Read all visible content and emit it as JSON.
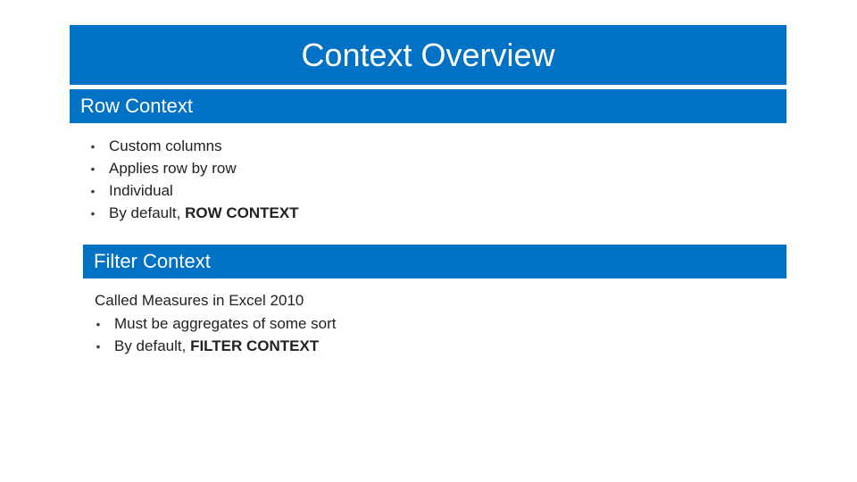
{
  "title": "Context Overview",
  "section1": {
    "label": "Row Context",
    "items": [
      {
        "text": "Custom columns"
      },
      {
        "text": "Applies row by row"
      },
      {
        "text": "Individual"
      },
      {
        "prefix": "By default, ",
        "bold": "ROW CONTEXT"
      }
    ]
  },
  "section2": {
    "label": "Filter Context",
    "lead": "Called Measures in Excel 2010",
    "items": [
      {
        "text": "Must be aggregates of some sort"
      },
      {
        "prefix": "By default, ",
        "bold": "FILTER CONTEXT"
      }
    ]
  }
}
